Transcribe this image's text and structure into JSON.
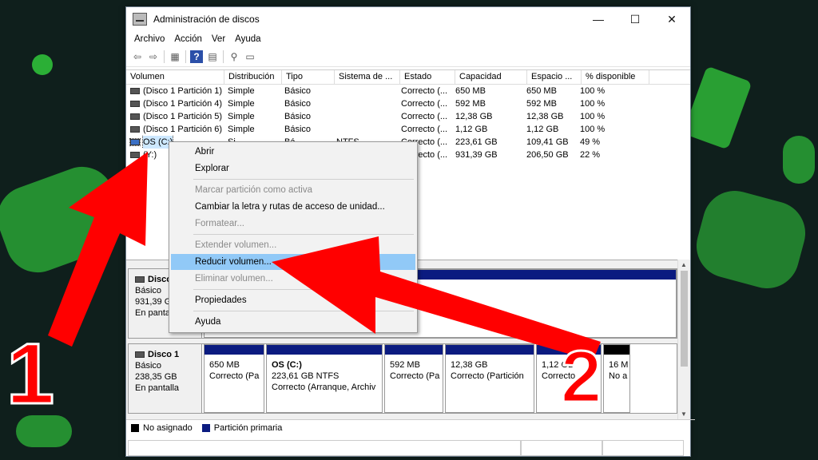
{
  "window": {
    "title": "Administración de discos",
    "buttons": {
      "minimize": "—",
      "maximize": "☐",
      "close": "✕"
    }
  },
  "menu": [
    "Archivo",
    "Acción",
    "Ver",
    "Ayuda"
  ],
  "volume_table": {
    "columns": [
      "Volumen",
      "Distribución",
      "Tipo",
      "Sistema de ...",
      "Estado",
      "Capacidad",
      "Espacio ...",
      "% disponible"
    ],
    "rows": [
      {
        "volumen": "(Disco 1 Partición 1)",
        "distribucion": "Simple",
        "tipo": "Básico",
        "sistema": "",
        "estado": "Correcto (...",
        "capacidad": "650 MB",
        "espacio": "650 MB",
        "pct": "100 %"
      },
      {
        "volumen": "(Disco 1 Partición 4)",
        "distribucion": "Simple",
        "tipo": "Básico",
        "sistema": "",
        "estado": "Correcto (...",
        "capacidad": "592 MB",
        "espacio": "592 MB",
        "pct": "100 %"
      },
      {
        "volumen": "(Disco 1 Partición 5)",
        "distribucion": "Simple",
        "tipo": "Básico",
        "sistema": "",
        "estado": "Correcto (...",
        "capacidad": "12,38 GB",
        "espacio": "12,38 GB",
        "pct": "100 %"
      },
      {
        "volumen": "(Disco 1 Partición 6)",
        "distribucion": "Simple",
        "tipo": "Básico",
        "sistema": "",
        "estado": "Correcto (...",
        "capacidad": "1,12 GB",
        "espacio": "1,12 GB",
        "pct": "100 %"
      },
      {
        "volumen": "OS (C:)",
        "distribucion": "Si",
        "tipo": "Bá",
        "sistema": "NTFS",
        "estado": "Correcto (...",
        "capacidad": "223,61 GB",
        "espacio": "109,41 GB",
        "pct": "49 %"
      },
      {
        "volumen": "(Y:)",
        "distribucion": "",
        "tipo": "",
        "sistema": "",
        "estado": "Correcto (...",
        "capacidad": "931,39 GB",
        "espacio": "206,50 GB",
        "pct": "22 %"
      }
    ]
  },
  "disk0": {
    "name": "Disco",
    "type": "Básico",
    "size": "931,39 GB",
    "status": "En pantalla"
  },
  "disk1": {
    "name": "Disco 1",
    "type": "Básico",
    "size": "238,35 GB",
    "status": "En pantalla",
    "partitions": [
      {
        "title": "",
        "size": "650 MB",
        "state": "Correcto (Pa"
      },
      {
        "title": "OS  (C:)",
        "size": "223,61 GB NTFS",
        "state": "Correcto (Arranque, Archiv"
      },
      {
        "title": "",
        "size": "592 MB",
        "state": "Correcto (Pa"
      },
      {
        "title": "",
        "size": "12,38 GB",
        "state": "Correcto (Partición"
      },
      {
        "title": "",
        "size": "1,12 GB",
        "state": "Correcto"
      },
      {
        "title": "",
        "size": "16 M",
        "state": "No a"
      }
    ]
  },
  "legend": {
    "unallocated": "No asignado",
    "primary": "Partición primaria"
  },
  "context_menu": {
    "open": "Abrir",
    "explore": "Explorar",
    "mark_active": "Marcar partición como activa",
    "change_letter": "Cambiar la letra y rutas de acceso de unidad...",
    "format": "Formatear...",
    "extend": "Extender volumen...",
    "shrink": "Reducir volumen...",
    "delete": "Eliminar volumen...",
    "properties": "Propiedades",
    "help": "Ayuda"
  },
  "annotations": {
    "one": "1",
    "two": "2"
  },
  "colors": {
    "primary_partition": "#0b1b80",
    "unallocated": "#000000",
    "highlight": "#91c9f7",
    "arrow": "#ff0000"
  }
}
